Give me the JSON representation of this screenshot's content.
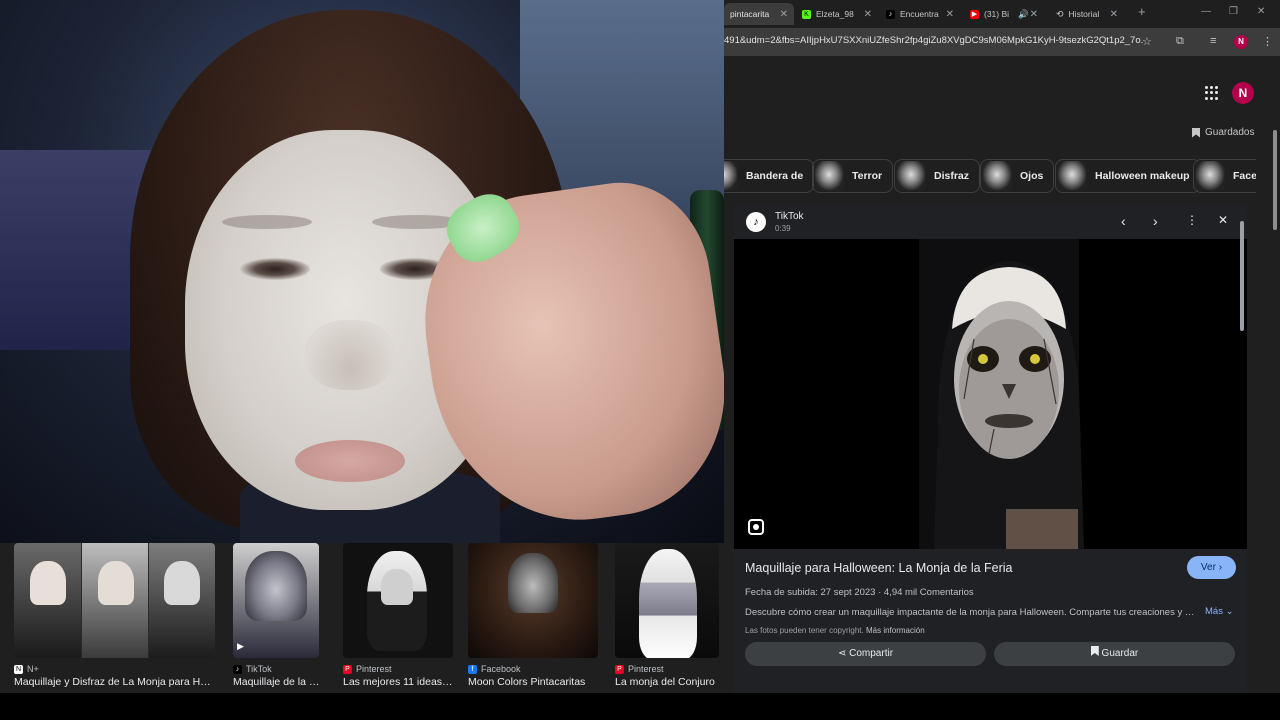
{
  "browser": {
    "tabs": [
      {
        "label": "pintacarita",
        "active": true,
        "favicon": "pinterest-icon"
      },
      {
        "label": "Elzeta_98",
        "active": false,
        "favicon": "kick-icon"
      },
      {
        "label": "Encuentra",
        "active": false,
        "favicon": "tiktok-icon"
      },
      {
        "label": "(31) Bi",
        "active": false,
        "favicon": "youtube-icon"
      },
      {
        "label": "Historial",
        "active": false,
        "favicon": "history-icon"
      }
    ],
    "new_tab": "+",
    "url": "491&udm=2&fbs=AIIjpHxU7SXXniUZfeShr2fp4giZu8XVgDC9sM06MpkG1KyH-9tsezkG2Qt1p2_7o...",
    "profile_initial": "N"
  },
  "page": {
    "profile_initial": "N",
    "saved_label": "Guardados",
    "chips": [
      "Bandera de",
      "Terror",
      "Disfraz",
      "Ojos",
      "Halloween makeup",
      "Face"
    ]
  },
  "preview": {
    "site": "TikTok",
    "duration": "0:39",
    "title": "Maquillaje para Halloween: La Monja de la Feria",
    "view_label": "Ver",
    "meta": "Fecha de subida: 27 sept 2023 · 4,94 mil Comentarios",
    "description": "Descubre cómo crear un maquillaje impactante de la monja para Halloween. Comparte tus creaciones y usa...",
    "more_label": "Más",
    "copyright": "Las fotos pueden tener copyright.",
    "more_info": "Más información",
    "share_label": "Compartir",
    "save_label": "Guardar"
  },
  "thumbnails": [
    {
      "source": "N+",
      "title": "Maquillaje y Disfraz de La Monja para Hallo..."
    },
    {
      "source": "TikTok",
      "title": "Maquillaje de la m..."
    },
    {
      "source": "Pinterest",
      "title": "Las mejores 11 ideas ..."
    },
    {
      "source": "Facebook",
      "title": "Moon Colors Pintacaritas"
    },
    {
      "source": "Pinterest",
      "title": "La monja del Conjuro"
    }
  ],
  "colors": {
    "accent": "#8ab4f8",
    "page_bg": "#1f1f1f",
    "profile": "#b3004a"
  }
}
